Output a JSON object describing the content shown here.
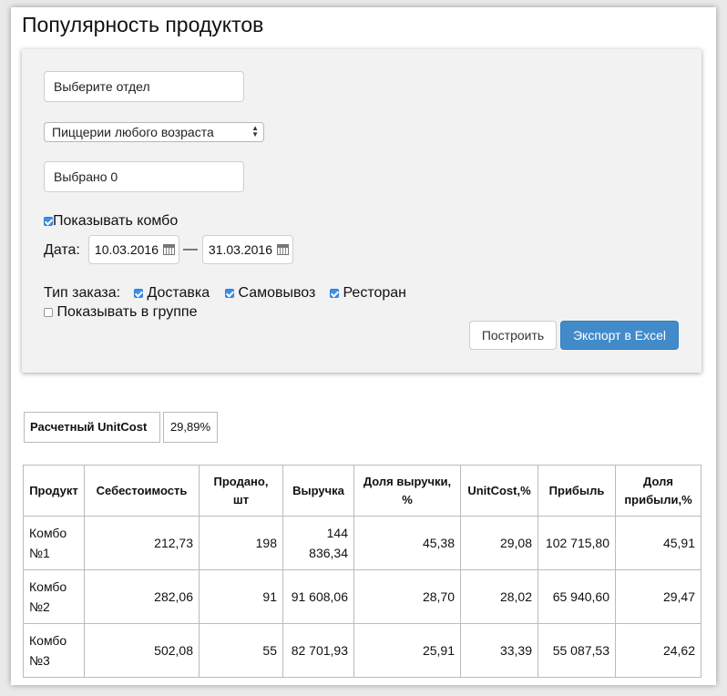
{
  "page": {
    "title": "Популярность продуктов"
  },
  "filters": {
    "department_placeholder": "Выберите отдел",
    "pizzeria_select": "Пиццерии любого возраста",
    "selected_text": "Выбрано 0",
    "show_combo": {
      "label": "Показывать комбо",
      "checked": true
    },
    "date": {
      "label": "Дата:",
      "from": "10.03.2016",
      "separator": "—",
      "to": "31.03.2016"
    },
    "order_type": {
      "label": "Тип заказа:",
      "options": [
        {
          "label": "Доставка",
          "checked": true
        },
        {
          "label": "Самовывоз",
          "checked": true
        },
        {
          "label": "Ресторан",
          "checked": true
        }
      ]
    },
    "show_in_group": {
      "label": "Показывать в группе",
      "checked": false
    },
    "build_button": "Построить",
    "export_button": "Экспорт в Excel"
  },
  "unitcost": {
    "label": "Расчетный UnitCost",
    "value": "29,89%"
  },
  "table": {
    "headers": [
      "Продукт",
      "Себестоимость",
      "Продано, шт",
      "Выручка",
      "Доля выручки, %",
      "UnitCost,%",
      "Прибыль",
      "Доля прибыли,%"
    ],
    "rows": [
      [
        "Комбо №1",
        "212,73",
        "198",
        "144 836,34",
        "45,38",
        "29,08",
        "102 715,80",
        "45,91"
      ],
      [
        "Комбо №2",
        "282,06",
        "91",
        "91 608,06",
        "28,70",
        "28,02",
        "65 940,60",
        "29,47"
      ],
      [
        "Комбо №3",
        "502,08",
        "55",
        "82 701,93",
        "25,91",
        "33,39",
        "55 087,53",
        "24,62"
      ]
    ]
  },
  "colors": {
    "primary_button": "#428bca",
    "checkbox": "#3d8ee8",
    "panel": "#f2f2f2"
  }
}
